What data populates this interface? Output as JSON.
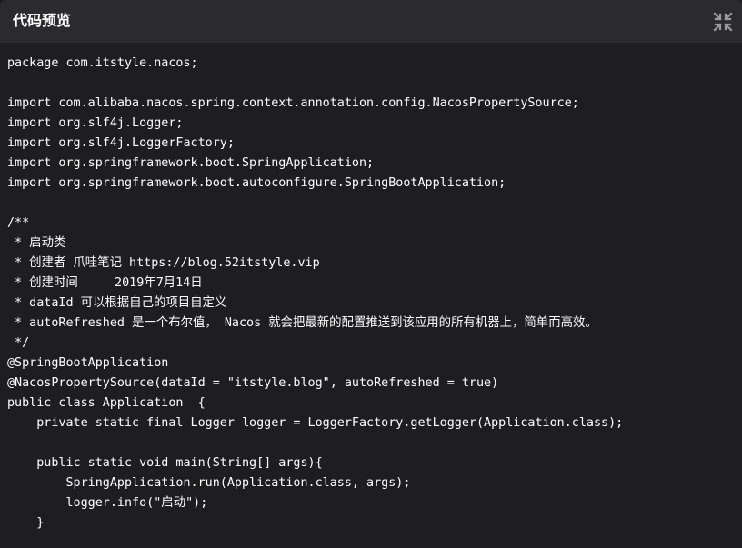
{
  "header": {
    "title": "代码预览",
    "collapse_icon": "collapse-arrows-icon"
  },
  "code": {
    "language": "java",
    "lines": [
      "package com.itstyle.nacos;",
      "",
      "import com.alibaba.nacos.spring.context.annotation.config.NacosPropertySource;",
      "import org.slf4j.Logger;",
      "import org.slf4j.LoggerFactory;",
      "import org.springframework.boot.SpringApplication;",
      "import org.springframework.boot.autoconfigure.SpringBootApplication;",
      "",
      "/**",
      " * 启动类",
      " * 创建者 爪哇笔记 https://blog.52itstyle.vip",
      " * 创建时间     2019年7月14日",
      " * dataId 可以根据自己的项目自定义",
      " * autoRefreshed 是一个布尔值， Nacos 就会把最新的配置推送到该应用的所有机器上，简单而高效。",
      " */",
      "@SpringBootApplication",
      "@NacosPropertySource(dataId = \"itstyle.blog\", autoRefreshed = true)",
      "public class Application  {",
      "    private static final Logger logger = LoggerFactory.getLogger(Application.class);",
      "",
      "    public static void main(String[] args){",
      "        SpringApplication.run(Application.class, args);",
      "        logger.info(\"启动\");",
      "    }"
    ]
  },
  "colors": {
    "header_bg": "#2b2b2d",
    "code_bg": "#1e1e20",
    "text": "#ffffff",
    "icon": "#9a9a9a"
  }
}
